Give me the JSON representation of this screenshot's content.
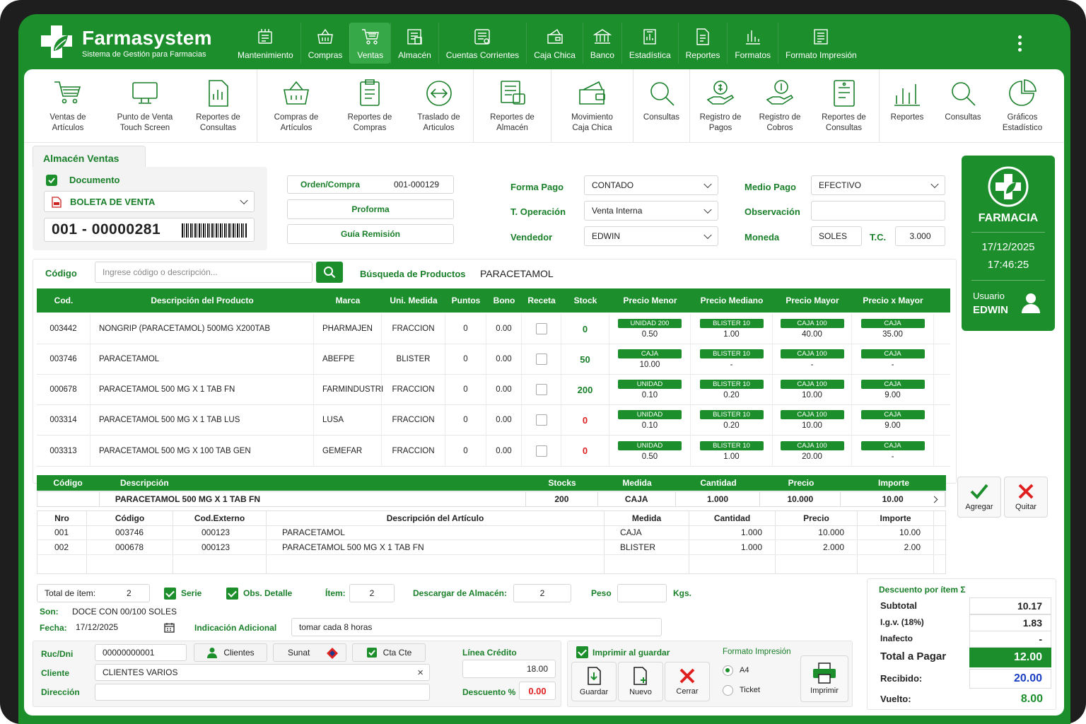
{
  "app": {
    "name": "Farmasystem",
    "subtitle": "Sistema de Gestión para Farmacias"
  },
  "nav": [
    {
      "label": "Mantenimiento",
      "icon": "maintenance-icon"
    },
    {
      "label": "Compras",
      "icon": "basket-icon"
    },
    {
      "label": "Ventas",
      "icon": "cart-icon",
      "active": true
    },
    {
      "label": "Almacén",
      "icon": "warehouse-icon"
    },
    {
      "label": "Cuentas Corrientes",
      "icon": "accounts-icon"
    },
    {
      "label": "Caja Chica",
      "icon": "cashbox-icon"
    },
    {
      "label": "Banco",
      "icon": "bank-icon"
    },
    {
      "label": "Estadística",
      "icon": "building-chart-icon"
    },
    {
      "label": "Reportes",
      "icon": "report-icon"
    },
    {
      "label": "Formatos",
      "icon": "format-icon"
    },
    {
      "label": "Formato Impresión",
      "icon": "print-format-icon"
    }
  ],
  "toolbar": [
    {
      "l1": "Ventas de",
      "l2": "Artículos"
    },
    {
      "l1": "Punto de Venta",
      "l2": "Touch Screen"
    },
    {
      "l1": "Reportes de",
      "l2": "Consultas"
    },
    {
      "l1": "Compras de",
      "l2": "Artículos"
    },
    {
      "l1": "Reportes de",
      "l2": "Compras"
    },
    {
      "l1": "Traslado de",
      "l2": "Articulos"
    },
    {
      "l1": "Reportes de",
      "l2": "Almacén"
    },
    {
      "l1": "Movimiento",
      "l2": "Caja Chica"
    },
    {
      "l1": "Consultas",
      "l2": ""
    },
    {
      "l1": "Registro de",
      "l2": "Pagos"
    },
    {
      "l1": "Registro de",
      "l2": "Cobros"
    },
    {
      "l1": "Reportes de",
      "l2": "Consultas"
    },
    {
      "l1": "Reportes",
      "l2": ""
    },
    {
      "l1": "Consultas",
      "l2": ""
    },
    {
      "l1": "Gráficos",
      "l2": "Estadístico"
    }
  ],
  "form": {
    "tab": "Almacén Ventas",
    "documento_label": "Documento",
    "documento_tipo": "BOLETA DE VENTA",
    "serie_numero": "001 - 00000281",
    "orden_label": "Orden/Compra",
    "orden_value": "001-000129",
    "proforma": "Proforma",
    "guia": "Guía Remisión",
    "forma_pago_label": "Forma Pago",
    "forma_pago": "CONTADO",
    "t_operacion_label": "T. Operación",
    "t_operacion": "Venta Interna",
    "vendedor_label": "Vendedor",
    "vendedor": "EDWIN",
    "medio_pago_label": "Medio Pago",
    "medio_pago": "EFECTIVO",
    "observacion_label": "Observación",
    "moneda_label": "Moneda",
    "moneda": "SOLES",
    "tc_label": "T.C.",
    "tc": "3.000"
  },
  "side": {
    "title": "FARMACIA",
    "date": "17/12/2025",
    "time": "17:46:25",
    "user_label": "Usuario",
    "user": "EDWIN"
  },
  "search": {
    "label": "Código",
    "placeholder": "Ingrese código o descripción...",
    "busqueda_label": "Búsqueda de Productos",
    "term": "PARACETAMOL"
  },
  "products": {
    "headers": [
      "Cod.",
      "Descripción del Producto",
      "Marca",
      "Uni. Medida",
      "Puntos",
      "Bono",
      "Receta",
      "Stock",
      "Precio Menor",
      "Precio Mediano",
      "Precio Mayor",
      "Precio x Mayor"
    ],
    "rows": [
      {
        "cod": "003442",
        "desc": "NONGRIP (PARACETAMOL) 500MG X200TAB",
        "marca": "PHARMAJEN",
        "um": "FRACCION",
        "puntos": "0",
        "bono": "0.00",
        "stock": "0",
        "stock_color": "#197f29",
        "p1t": "UNIDAD 200",
        "p1": "0.50",
        "p2t": "BLISTER 10",
        "p2": "1.00",
        "p3t": "CAJA 100",
        "p3": "40.00",
        "p4t": "CAJA",
        "p4": "35.00"
      },
      {
        "cod": "003746",
        "desc": "PARACETAMOL",
        "marca": "ABEFPE",
        "um": "BLISTER",
        "puntos": "0",
        "bono": "0.00",
        "stock": "50",
        "stock_color": "#197f29",
        "p1t": "CAJA",
        "p1": "10.00",
        "p2t": "BLISTER 10",
        "p2": "-",
        "p3t": "CAJA 100",
        "p3": "-",
        "p4t": "CAJA",
        "p4": "-"
      },
      {
        "cod": "000678",
        "desc": "PARACETAMOL 500 MG X 1 TAB FN",
        "marca": "FARMINDUSTRI",
        "um": "FRACCION",
        "puntos": "0",
        "bono": "0.00",
        "stock": "200",
        "stock_color": "#197f29",
        "p1t": "UNIDAD",
        "p1": "0.10",
        "p2t": "BLISTER 10",
        "p2": "0.20",
        "p3t": "CAJA 100",
        "p3": "10.00",
        "p4t": "CAJA",
        "p4": "9.00"
      },
      {
        "cod": "003314",
        "desc": "PARACETAMOL 500 MG X 1 TAB LUS",
        "marca": "LUSA",
        "um": "FRACCION",
        "puntos": "0",
        "bono": "0.00",
        "stock": "0",
        "stock_color": "#e02020",
        "p1t": "UNIDAD",
        "p1": "0.10",
        "p2t": "BLISTER 10",
        "p2": "0.20",
        "p3t": "CAJA 100",
        "p3": "10.00",
        "p4t": "CAJA",
        "p4": "9.00"
      },
      {
        "cod": "003313",
        "desc": "PARACETAMOL 500 MG X 100 TAB GEN",
        "marca": "GEMEFAR",
        "um": "FRACCION",
        "puntos": "0",
        "bono": "0.00",
        "stock": "0",
        "stock_color": "#e02020",
        "p1t": "UNIDAD",
        "p1": "0.50",
        "p2t": "BLISTER 10",
        "p2": "1.00",
        "p3t": "CAJA 100",
        "p3": "20.00",
        "p4t": "CAJA",
        "p4": "-"
      }
    ]
  },
  "entry": {
    "headers": [
      "Código",
      "Descripción",
      "Stocks",
      "Medida",
      "Cantidad",
      "Precio",
      "Importe"
    ],
    "codigo": "",
    "descripcion": "PARACETAMOL 500 MG X 1 TAB FN",
    "stocks": "200",
    "medida": "CAJA",
    "cantidad": "1.000",
    "precio": "10.000",
    "importe": "10.00",
    "agregar": "Agregar",
    "quitar": "Quitar"
  },
  "items": {
    "headers": [
      "Nro",
      "Código",
      "Cod.Externo",
      "Descripción del Artículo",
      "Medida",
      "Cantidad",
      "Precio",
      "Importe"
    ],
    "rows": [
      {
        "nro": "001",
        "codigo": "003746",
        "ext": "000123",
        "desc": "PARACETAMOL",
        "medida": "CAJA",
        "cantidad": "1.000",
        "precio": "10.000",
        "importe": "10.00"
      },
      {
        "nro": "002",
        "codigo": "000678",
        "ext": "000123",
        "desc": "PARACETAMOL 500 MG X 1 TAB FN",
        "medida": "BLISTER",
        "cantidad": "1.000",
        "precio": "2.000",
        "importe": "2.00"
      }
    ]
  },
  "footer": {
    "total_item_label": "Total de ítem:",
    "total_item": "2",
    "serie_label": "Serie",
    "obs_label": "Obs. Detalle",
    "item_label": "Ítem:",
    "item": "2",
    "descargar_label": "Descargar de Almacén:",
    "descargar": "2",
    "peso_label": "Peso",
    "peso": "",
    "kgs_label": "Kgs.",
    "son_label": "Son:",
    "son": "DOCE CON 00/100 SOLES",
    "fecha_label": "Fecha:",
    "fecha": "17/12/2025",
    "ind_label": "Indicación Adicional",
    "ind": "tomar cada 8 horas",
    "ruc_label": "Ruc/Dni",
    "ruc": "00000000001",
    "clientes_btn": "Clientes",
    "sunat_btn": "Sunat",
    "ctacte_btn": "Cta Cte",
    "cliente_label": "Cliente",
    "cliente": "CLIENTES VARIOS",
    "direccion_label": "Dirección",
    "direccion": "",
    "linea_label": "Línea Crédito",
    "linea": "18.00",
    "desc_label": "Descuento %",
    "desc": "0.00",
    "imprimir_guardar": "Imprimir al guardar",
    "guardar": "Guardar",
    "nuevo": "Nuevo",
    "cerrar": "Cerrar",
    "formato_label": "Formato Impresión",
    "a4": "A4",
    "ticket": "Ticket",
    "imprimir": "Imprimir"
  },
  "totals": {
    "title": "Descuento por ítem Σ",
    "subtotal_label": "Subtotal",
    "subtotal": "10.17",
    "igv_label": "I.g.v.  (18%)",
    "igv": "1.83",
    "inafecto_label": "Inafecto",
    "inafecto": "-",
    "total_label": "Total a Pagar",
    "total": "12.00",
    "recibido_label": "Recibido:",
    "recibido": "20.00",
    "vuelto_label": "Vuelto:",
    "vuelto": "8.00"
  }
}
